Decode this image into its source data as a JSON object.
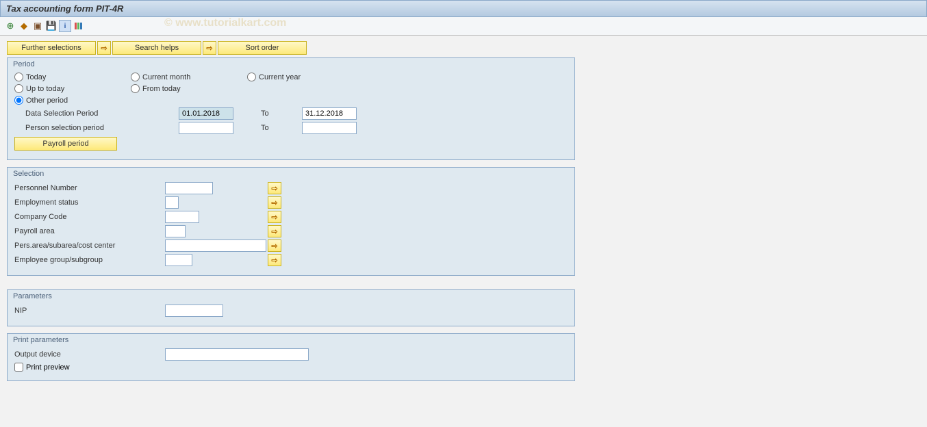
{
  "title": "Tax accounting form PIT-4R",
  "watermark": "© www.tutorialkart.com",
  "buttons": {
    "further_selections": "Further selections",
    "search_helps": "Search helps",
    "sort_order": "Sort order",
    "payroll_period": "Payroll period"
  },
  "period_panel": {
    "title": "Period",
    "radios": {
      "today": "Today",
      "current_month": "Current month",
      "current_year": "Current year",
      "up_to_today": "Up to today",
      "from_today": "From today",
      "other_period": "Other period"
    },
    "data_sel_label": "Data Selection Period",
    "data_sel_from": "01.01.2018",
    "data_sel_to_label": "To",
    "data_sel_to": "31.12.2018",
    "person_sel_label": "Person selection period",
    "person_sel_from": "",
    "person_sel_to_label": "To",
    "person_sel_to": ""
  },
  "selection_panel": {
    "title": "Selection",
    "rows": {
      "personnel_number": "Personnel Number",
      "employment_status": "Employment status",
      "company_code": "Company Code",
      "payroll_area": "Payroll area",
      "pers_area": "Pers.area/subarea/cost center",
      "emp_group": "Employee group/subgroup"
    }
  },
  "parameters_panel": {
    "title": "Parameters",
    "nip_label": "NIP"
  },
  "print_panel": {
    "title": "Print parameters",
    "output_device_label": "Output device",
    "print_preview_label": "Print preview"
  }
}
